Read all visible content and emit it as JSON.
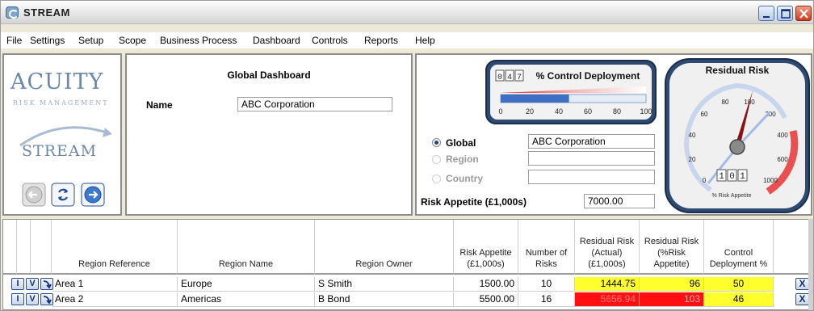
{
  "window": {
    "title": "STREAM"
  },
  "menu": [
    "File",
    "Settings",
    "Setup",
    "Scope",
    "Business Process",
    "Dashboard",
    "Controls",
    "Reports",
    "Help"
  ],
  "logo": {
    "brand": "ACUITY",
    "tagline": "RISK MANAGEMENT",
    "product": "STREAM"
  },
  "dashboard": {
    "title": "Global Dashboard",
    "name_label": "Name",
    "name_value": "ABC Corporation"
  },
  "filters": {
    "global_label": "Global",
    "global_value": "ABC Corporation",
    "region_label": "Region",
    "region_value": "",
    "country_label": "Country",
    "country_value": "",
    "selected": "Global",
    "risk_appetite_label": "Risk Appetite (£1,000s)",
    "risk_appetite_value": "7000.00"
  },
  "control_gauge": {
    "title": "% Control Deployment",
    "digits": [
      "0",
      "4",
      "7"
    ],
    "value": 47,
    "ticks": [
      "0",
      "20",
      "40",
      "60",
      "80",
      "100"
    ]
  },
  "residual_gauge": {
    "title": "Residual Risk",
    "digits": [
      "1",
      "0",
      "1"
    ],
    "value": 101,
    "ticks": [
      "0",
      "20",
      "40",
      "60",
      "80",
      "100",
      "200",
      "400",
      "600",
      "1000"
    ],
    "caption": "% Risk Appetite"
  },
  "table": {
    "headers": [
      "Region Reference",
      "Region Name",
      "Region Owner",
      "Risk Appetite (£1,000s)",
      "Number of Risks",
      "Residual Risk (Actual) (£1,000s)",
      "Residual Risk (%Risk Appetite)",
      "Control Deployment %"
    ],
    "rows": [
      {
        "ref": "Area 1",
        "name": "Europe",
        "owner": "S Smith",
        "appetite": "1500.00",
        "risks": "10",
        "residual": "1444.75",
        "pct": "96",
        "deploy": "50",
        "residual_color": "#ffff2e",
        "pct_color": "#ffff2e",
        "deploy_color": "#ffff2e"
      },
      {
        "ref": "Area 2",
        "name": "Americas",
        "owner": "B Bond",
        "appetite": "5500.00",
        "risks": "16",
        "residual": "5656.94",
        "pct": "103",
        "deploy": "46",
        "residual_color": "#ff1010",
        "pct_color": "#ff1010",
        "deploy_color": "#ffff2e"
      }
    ],
    "row_buttons": [
      "I",
      "V"
    ],
    "delete_label": "X"
  },
  "colors": {
    "accent": "#1d4f9c",
    "brand": "#6a87ac",
    "warning": "#ffff2e",
    "danger": "#ff1010"
  },
  "icons": {
    "nav_back": "back-arrow-icon",
    "nav_refresh": "refresh-icon",
    "nav_forward": "forward-arrow-icon",
    "row_drill": "drill-arrow-icon"
  }
}
